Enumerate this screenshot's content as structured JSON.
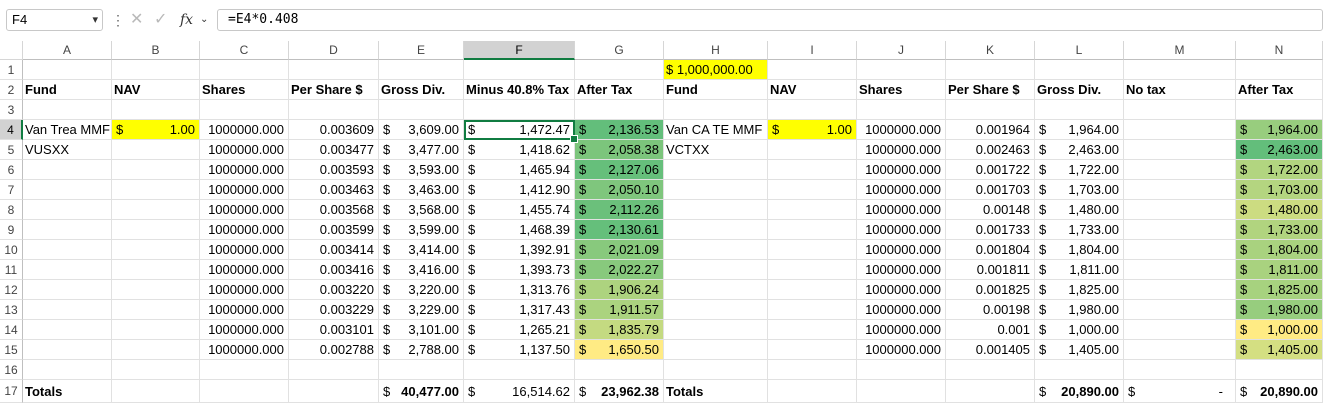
{
  "formula_bar": {
    "name_box": "F4",
    "separator": "⋮",
    "cancel_icon": "✕",
    "enter_icon": "✓",
    "fx_label": "fx",
    "formula": "=E4*0.408"
  },
  "columns": [
    "A",
    "B",
    "C",
    "D",
    "E",
    "F",
    "G",
    "H",
    "I",
    "J",
    "K",
    "L",
    "M",
    "N"
  ],
  "rows": [
    "1",
    "2",
    "3",
    "4",
    "5",
    "6",
    "7",
    "8",
    "9",
    "10",
    "11",
    "12",
    "13",
    "14",
    "15",
    "16",
    "17"
  ],
  "selected_column": "F",
  "selected_row": "4",
  "colors": {
    "highlight_yellow": "#ffff00",
    "selection_green": "#107c41",
    "scale_green": "#63be7b",
    "scale_yellow": "#ffeb84"
  },
  "h1_value": "$ 1,000,000.00",
  "headers": {
    "A": "Fund",
    "B": "NAV",
    "C": "Shares",
    "D": "Per Share $",
    "E": "Gross Div.",
    "F": "Minus 40.8% Tax",
    "G": "After Tax",
    "H": "Fund",
    "I": "NAV",
    "J": "Shares",
    "K": "Per Share $",
    "L": "Gross Div.",
    "M": "No tax",
    "N": "After Tax"
  },
  "funds": {
    "left_name": "Van Trea MMF",
    "left_ticker": "VUSXX",
    "left_nav": "1.00",
    "right_name": "Van CA TE MMF",
    "right_ticker": "VCTXX",
    "right_nav": "1.00"
  },
  "data_rows": [
    {
      "row": "4",
      "C": "1000000.000",
      "D": "0.003609",
      "E": "3,609.00",
      "F": "1,472.47",
      "G": "2,136.53",
      "J": "1000000.000",
      "K": "0.001964",
      "L": "1,964.00",
      "N": "1,964.00"
    },
    {
      "row": "5",
      "C": "1000000.000",
      "D": "0.003477",
      "E": "3,477.00",
      "F": "1,418.62",
      "G": "2,058.38",
      "J": "1000000.000",
      "K": "0.002463",
      "L": "2,463.00",
      "N": "2,463.00"
    },
    {
      "row": "6",
      "C": "1000000.000",
      "D": "0.003593",
      "E": "3,593.00",
      "F": "1,465.94",
      "G": "2,127.06",
      "J": "1000000.000",
      "K": "0.001722",
      "L": "1,722.00",
      "N": "1,722.00"
    },
    {
      "row": "7",
      "C": "1000000.000",
      "D": "0.003463",
      "E": "3,463.00",
      "F": "1,412.90",
      "G": "2,050.10",
      "J": "1000000.000",
      "K": "0.001703",
      "L": "1,703.00",
      "N": "1,703.00"
    },
    {
      "row": "8",
      "C": "1000000.000",
      "D": "0.003568",
      "E": "3,568.00",
      "F": "1,455.74",
      "G": "2,112.26",
      "J": "1000000.000",
      "K": "0.00148",
      "L": "1,480.00",
      "N": "1,480.00"
    },
    {
      "row": "9",
      "C": "1000000.000",
      "D": "0.003599",
      "E": "3,599.00",
      "F": "1,468.39",
      "G": "2,130.61",
      "J": "1000000.000",
      "K": "0.001733",
      "L": "1,733.00",
      "N": "1,733.00"
    },
    {
      "row": "10",
      "C": "1000000.000",
      "D": "0.003414",
      "E": "3,414.00",
      "F": "1,392.91",
      "G": "2,021.09",
      "J": "1000000.000",
      "K": "0.001804",
      "L": "1,804.00",
      "N": "1,804.00"
    },
    {
      "row": "11",
      "C": "1000000.000",
      "D": "0.003416",
      "E": "3,416.00",
      "F": "1,393.73",
      "G": "2,022.27",
      "J": "1000000.000",
      "K": "0.001811",
      "L": "1,811.00",
      "N": "1,811.00"
    },
    {
      "row": "12",
      "C": "1000000.000",
      "D": "0.003220",
      "E": "3,220.00",
      "F": "1,313.76",
      "G": "1,906.24",
      "J": "1000000.000",
      "K": "0.001825",
      "L": "1,825.00",
      "N": "1,825.00"
    },
    {
      "row": "13",
      "C": "1000000.000",
      "D": "0.003229",
      "E": "3,229.00",
      "F": "1,317.43",
      "G": "1,911.57",
      "J": "1000000.000",
      "K": "0.00198",
      "L": "1,980.00",
      "N": "1,980.00"
    },
    {
      "row": "14",
      "C": "1000000.000",
      "D": "0.003101",
      "E": "3,101.00",
      "F": "1,265.21",
      "G": "1,835.79",
      "J": "1000000.000",
      "K": "0.001",
      "L": "1,000.00",
      "N": "1,000.00"
    },
    {
      "row": "15",
      "C": "1000000.000",
      "D": "0.002788",
      "E": "2,788.00",
      "F": "1,137.50",
      "G": "1,650.50",
      "J": "1000000.000",
      "K": "0.001405",
      "L": "1,405.00",
      "N": "1,405.00"
    }
  ],
  "totals": {
    "A": "Totals",
    "E": "40,477.00",
    "F": "16,514.62",
    "G": "23,962.38",
    "H": "Totals",
    "L": "20,890.00",
    "M": "-",
    "N": "20,890.00"
  },
  "currency_symbol": "$"
}
